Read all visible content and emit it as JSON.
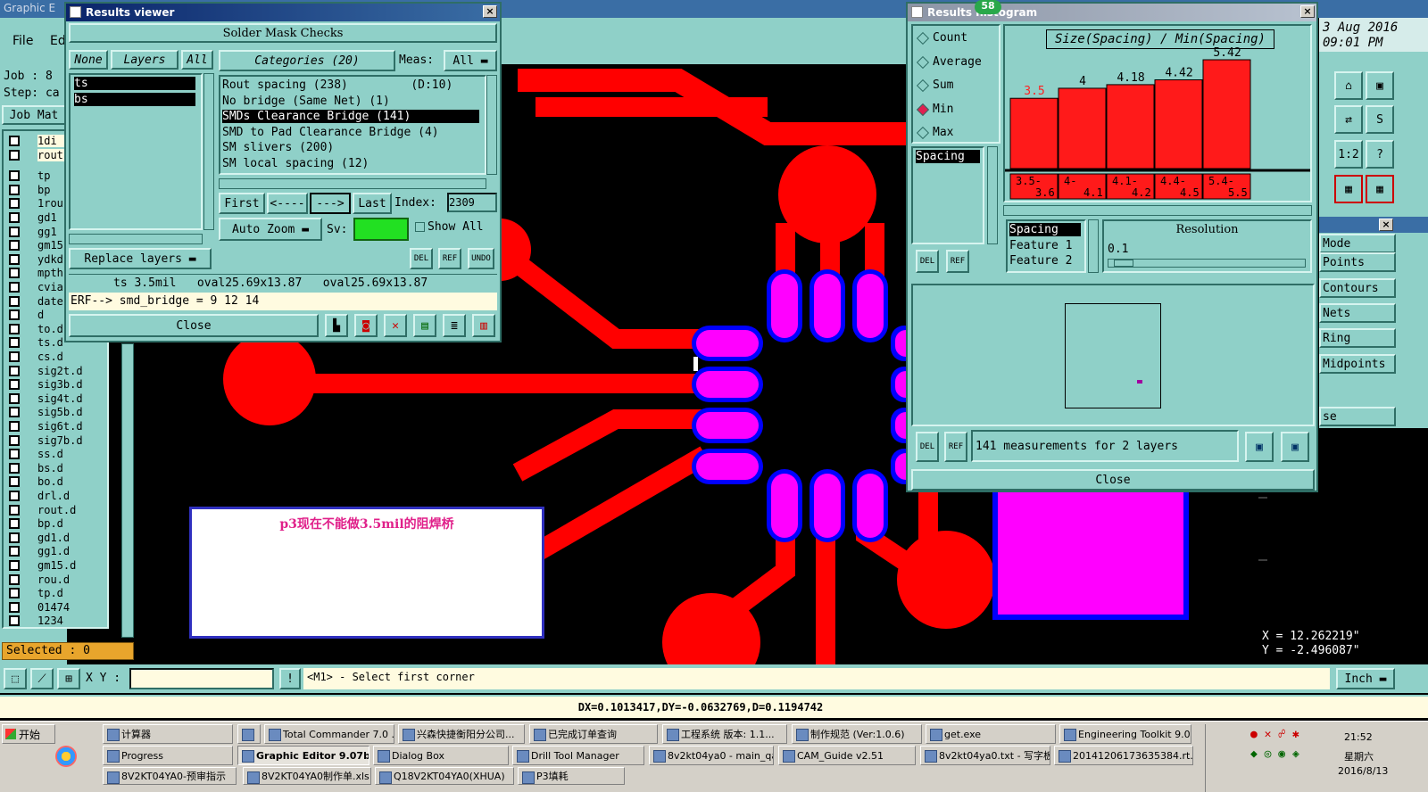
{
  "graphic_editor": {
    "title": "Graphic E",
    "menu": {
      "file": "File",
      "edit": "Ed"
    },
    "job_label": "Job : 8",
    "step_label": "Step: ca",
    "job_matrix": "Job Mat",
    "layers": [
      "1di",
      "rout",
      "tp",
      "bp",
      "1rou",
      "gd1",
      "gg1",
      "gm15",
      "ydkd",
      "mpth",
      "cvia",
      "date",
      "d",
      "to.d",
      "ts.d",
      "cs.d",
      "sig2t.d",
      "sig3b.d",
      "sig4t.d",
      "sig5b.d",
      "sig6t.d",
      "sig7b.d",
      "ss.d",
      "bs.d",
      "bo.d",
      "drl.d",
      "rout.d",
      "bp.d",
      "gd1.d",
      "gg1.d",
      "gm15.d",
      "rou.d",
      "tp.d",
      "01474",
      "1234"
    ],
    "selected": "Selected : 0",
    "xy_label": "X Y :",
    "xy_value": "",
    "prompt": "<M1> - Select first corner",
    "units": "Inch",
    "status": "DX=0.1013417,DY=-0.0632769,D=0.1194742",
    "date_line1": "3 Aug 2016",
    "date_line2": "09:01 PM",
    "coord_x": "X = 12.262219\"",
    "coord_y": "Y = -2.496087\"",
    "right_menu": [
      "Mode",
      "Points",
      "Contours",
      "Nets",
      "Ring",
      "Midpoints",
      "se"
    ]
  },
  "results_viewer": {
    "title": "Results viewer",
    "header": "Solder Mask Checks",
    "layer_tabs": {
      "none": "None",
      "layers": "Layers",
      "all": "All"
    },
    "layers": [
      "ts",
      "bs"
    ],
    "categories_label": "Categories (20)",
    "meas_label": "Meas:",
    "meas_value": "All",
    "categories": [
      "Rout spacing (238)         (D:10)",
      "No bridge (Same Net) (1)",
      "SMDs Clearance Bridge (141)",
      "SMD to Pad Clearance Bridge (4)",
      "SM slivers (200)",
      "SM local spacing (12)"
    ],
    "selected_category_index": 2,
    "nav": {
      "first": "First",
      "prev": "<----",
      "next": "--->",
      "last": "Last",
      "index_label": "Index:",
      "index_value": "2309"
    },
    "auto_zoom": "Auto Zoom",
    "sv_label": "Sv:",
    "show_all": "Show All",
    "replace_layers": "Replace layers",
    "del": "DEL",
    "ref": "REF",
    "undo": "UNDO",
    "info_line": "ts 3.5mil   oval25.69x13.87   oval25.69x13.87",
    "erf_line": "ERF--> smd_bridge = 9 12 14",
    "close": "Close"
  },
  "histogram": {
    "title": "Results histogram",
    "badge": "58",
    "stats": [
      "Count",
      "Average",
      "Sum",
      "Min",
      "Max"
    ],
    "selected_stat": "Min",
    "chart_title": "Size(Spacing) / Min(Spacing)",
    "measure_list": [
      "Spacing"
    ],
    "spacing_box": [
      "Spacing",
      "Feature 1",
      "Feature 2"
    ],
    "resolution_label": "Resolution",
    "resolution_value": "0.1",
    "summary": "141 measurements for 2 layers",
    "close": "Close",
    "del": "DEL",
    "ref": "REF"
  },
  "chart_data": {
    "type": "bar",
    "title": "Size(Spacing) / Min(Spacing)",
    "categories": [
      "3.5-3.6",
      "4-4.1",
      "4.1-4.2",
      "4.4-4.5",
      "5.4-5.5"
    ],
    "values": [
      3.5,
      4,
      4.18,
      4.42,
      5.42
    ],
    "value_labels": [
      "3.5",
      "4",
      "4.18",
      "4.42",
      "5.42"
    ],
    "bar_color": "#ff1a1a",
    "first_label_color": "#ff2020"
  },
  "note": {
    "text": "p3现在不能做3.5mil的阻焊桥"
  },
  "colors": {
    "teal": "#8fd0c8",
    "copper": "#ff0000",
    "mask": "#ff00ff",
    "outline": "#0000ff"
  },
  "taskbar": {
    "start": "开始",
    "row1": [
      "计算器",
      "",
      "Total Commander 7.0 ...",
      "兴森快捷衡阳分公司...",
      "已完成订单查询",
      "工程系统  版本: 1.1...",
      "制作规范 (Ver:1.0.6)",
      "get.exe",
      "Engineering Toolkit 9.0..."
    ],
    "row2": [
      "Progress",
      "Graphic Editor 9.07b...",
      "Dialog Box",
      "Drill Tool Manager",
      "8v2kt04ya0 - main_qa",
      "CAM_Guide v2.51",
      "8v2kt04ya0.txt - 写字板",
      "20141206173635384.rt..."
    ],
    "row3": [
      "8V2KT04YA0-预审指示",
      "8V2KT04YA0制作单.xls",
      "Q18V2KT04YA0(XHUA)",
      "P3填耗"
    ],
    "clock": "21:52",
    "weekday": "星期六",
    "date": "2016/8/13"
  }
}
